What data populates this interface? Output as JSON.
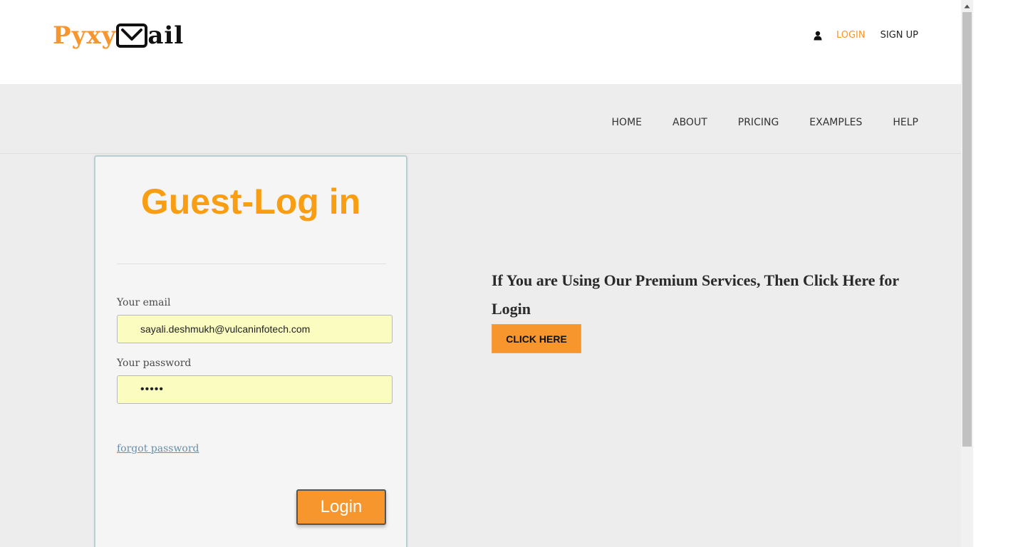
{
  "header": {
    "logo": {
      "part1": "Pyxy",
      "part2": "ail"
    },
    "links": {
      "login": "LOGIN",
      "signup": "SIGN UP"
    }
  },
  "nav": {
    "items": [
      "HOME",
      "ABOUT",
      "PRICING",
      "EXAMPLES",
      "HELP"
    ]
  },
  "login_card": {
    "title": "Guest-Log in",
    "email_label": "Your email",
    "email_value": "sayali.deshmukh@vulcaninfotech.com",
    "password_label": "Your password",
    "password_value": "•••••",
    "forgot_link": "forgot password",
    "login_button": "Login"
  },
  "premium": {
    "text": "If You are Using Our Premium Services, Then Click Here for Login",
    "button": "CLICK HERE"
  },
  "colors": {
    "accent": "#f6962c",
    "title_orange": "#f99e12",
    "input_bg": "#fafcc0",
    "page_bg": "#ededed"
  },
  "icons": {
    "user": "user-icon",
    "logo_mark": "envelope-icon",
    "scroll_up": "arrow-up-icon"
  }
}
